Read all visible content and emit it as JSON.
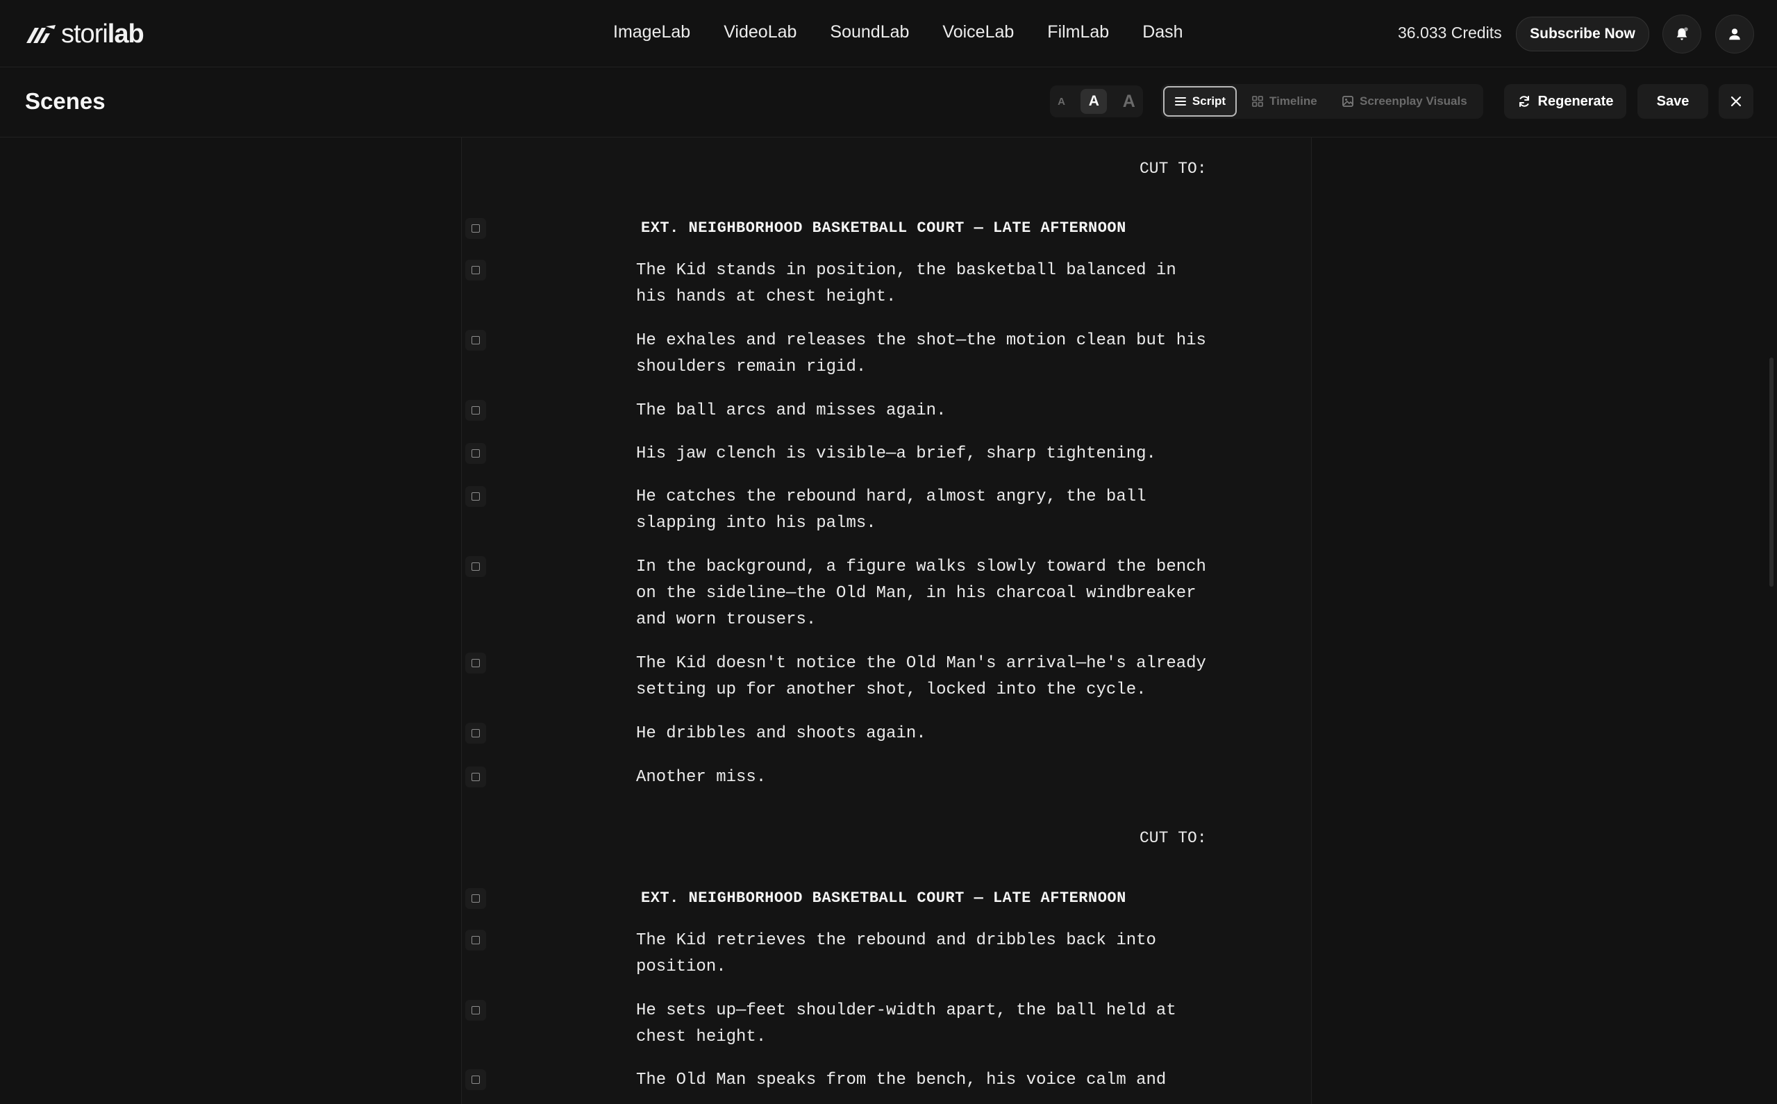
{
  "brand": {
    "logo_light": "stori",
    "logo_bold": "lab"
  },
  "nav": [
    "ImageLab",
    "VideoLab",
    "SoundLab",
    "VoiceLab",
    "FilmLab",
    "Dash"
  ],
  "credits": "36.033 Credits",
  "subscribe_label": "Subscribe Now",
  "page_title": "Scenes",
  "font_sizes": [
    "A",
    "A",
    "A"
  ],
  "view_tabs": [
    "Script",
    "Timeline",
    "Screenplay Visuals"
  ],
  "regenerate_label": "Regenerate",
  "save_label": "Save",
  "script": {
    "cut1": "CUT TO:",
    "heading1": "EXT. NEIGHBORHOOD BASKETBALL COURT — LATE AFTERNOON",
    "a1": "The Kid stands in position, the basketball balanced in\nhis hands at chest height.",
    "a2": "He exhales and releases the shot—the motion clean but his\nshoulders remain rigid.",
    "a3": "The ball arcs and misses again.",
    "a4": "His jaw clench is visible—a brief, sharp tightening.",
    "a5": "He catches the rebound hard, almost angry, the ball\nslapping into his palms.",
    "a6": "In the background, a figure walks slowly toward the bench\non the sideline—the Old Man, in his charcoal windbreaker\nand worn trousers.",
    "a7": "The Kid doesn't notice the Old Man's arrival—he's already\nsetting up for another shot, locked into the cycle.",
    "a8": "He dribbles and shoots again.",
    "a9": "Another miss.",
    "cut2": "CUT TO:",
    "heading2": "EXT. NEIGHBORHOOD BASKETBALL COURT — LATE AFTERNOON",
    "b1": "The Kid retrieves the rebound and dribbles back into\nposition.",
    "b2": "He sets up—feet shoulder-width apart, the ball held at\nchest height.",
    "b3": "The Old Man speaks from the bench, his voice calm and"
  }
}
